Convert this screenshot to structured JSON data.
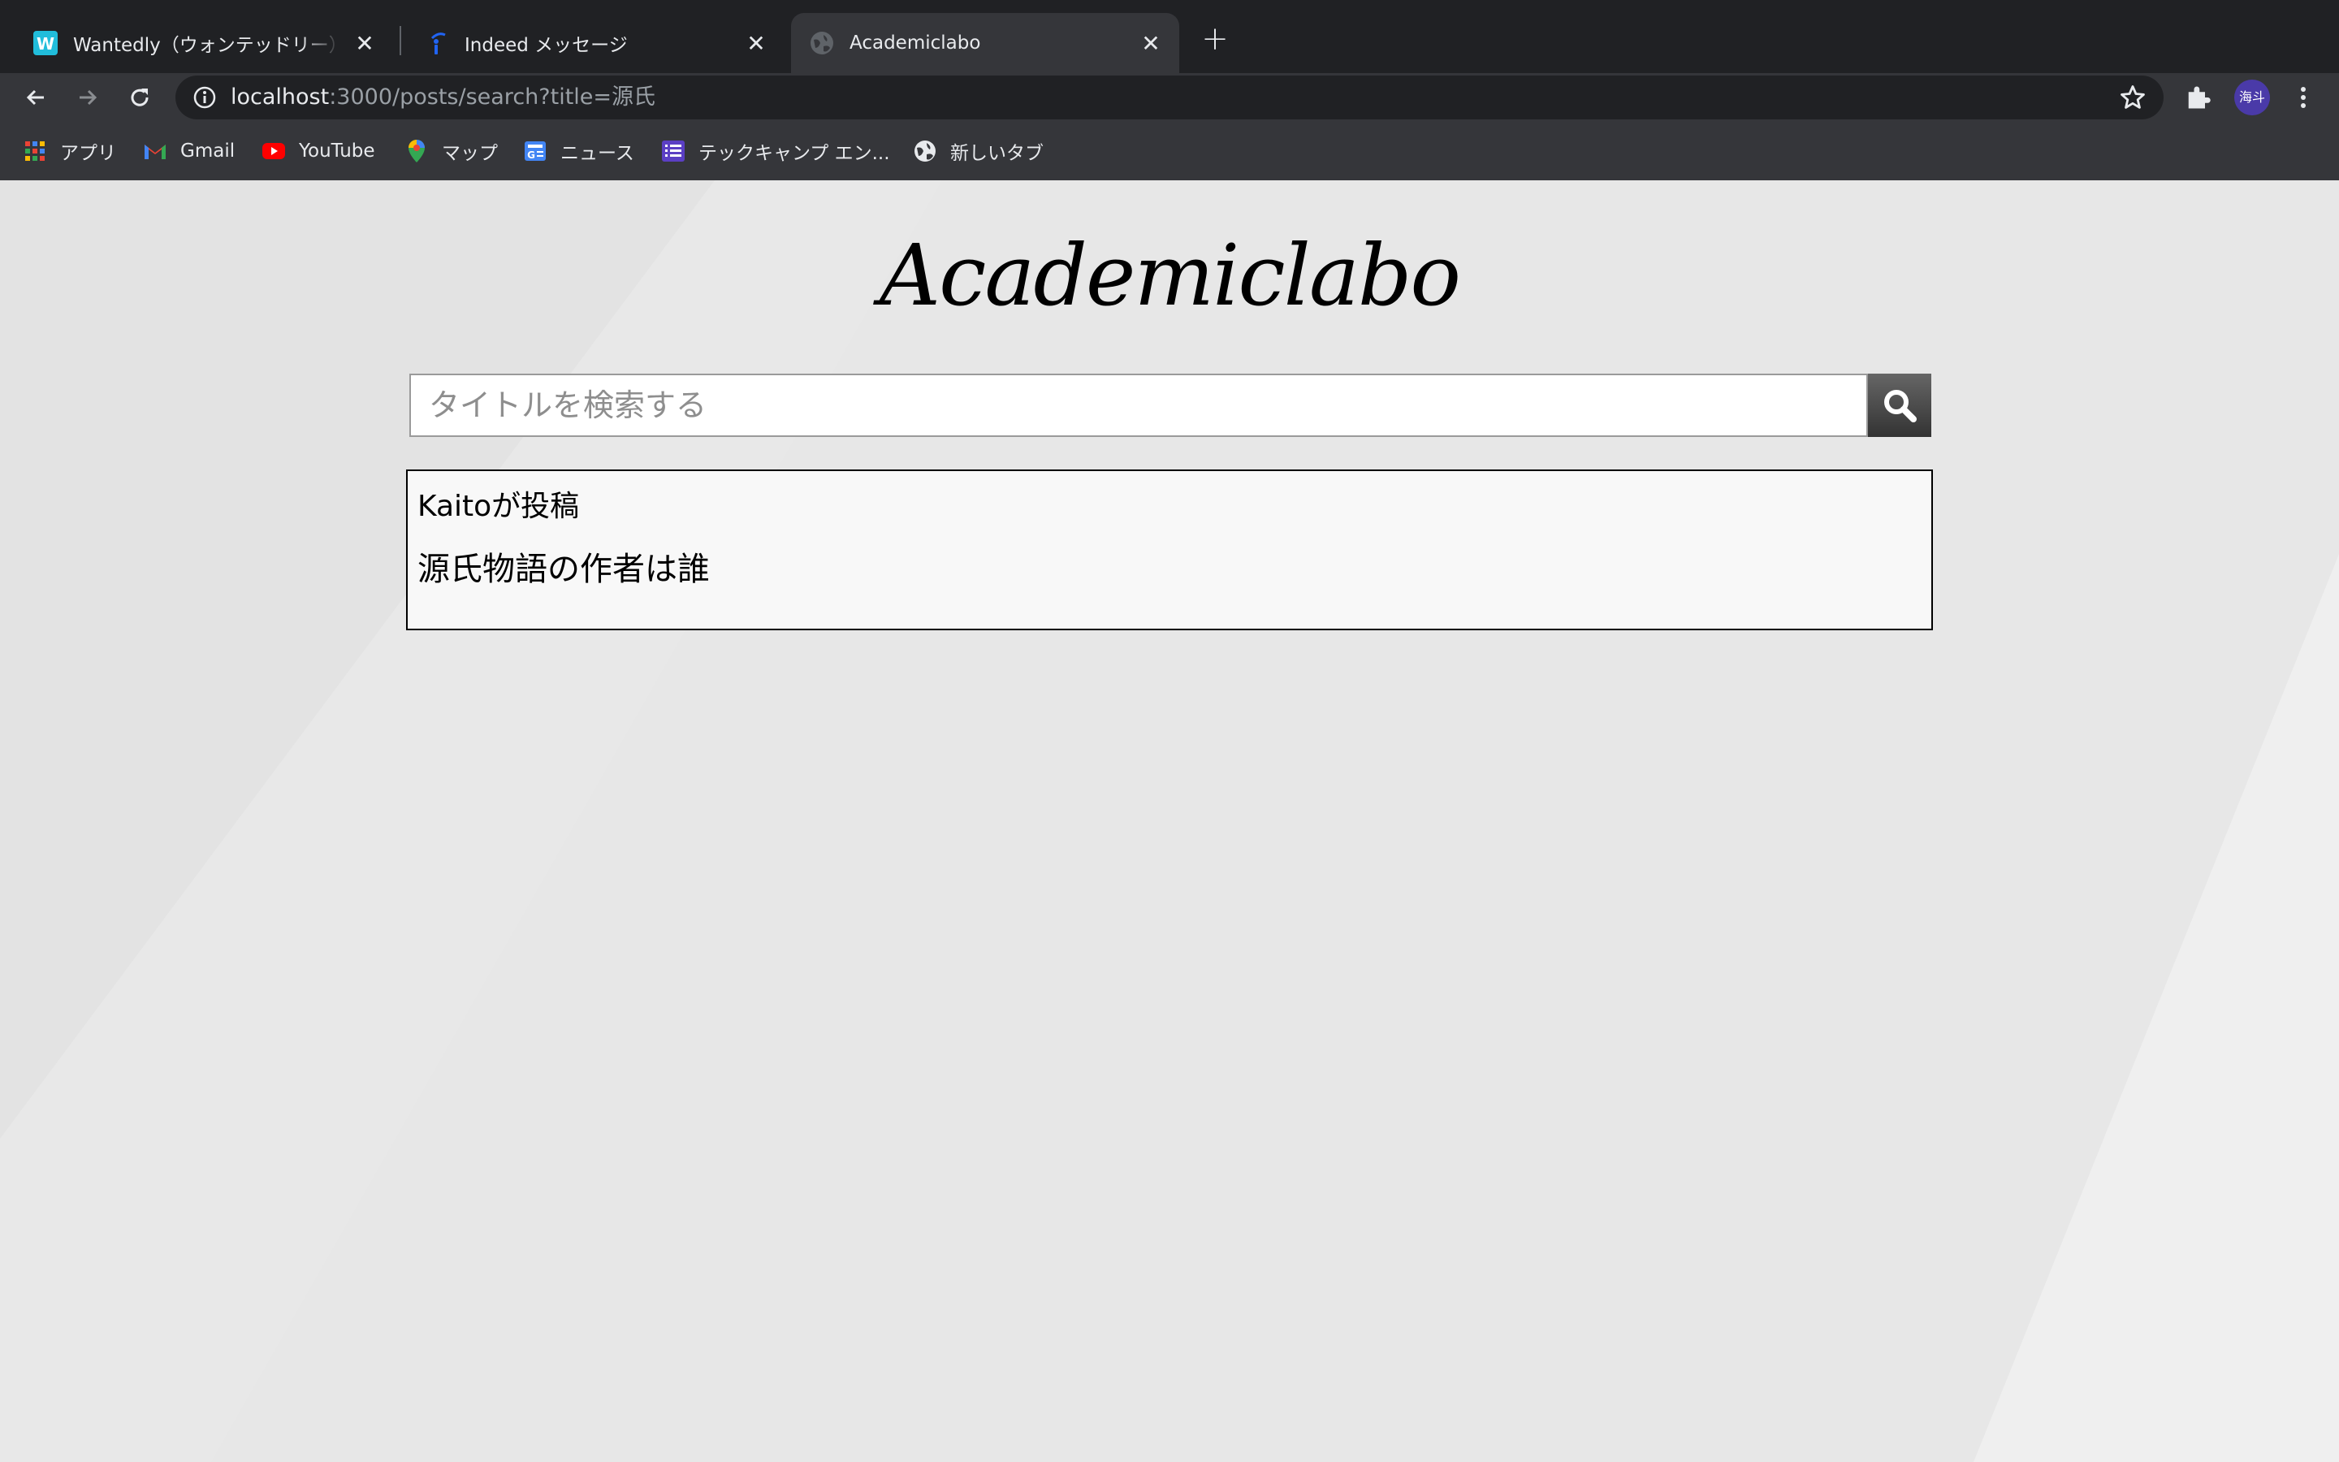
{
  "browser": {
    "tabs": [
      {
        "title": "Wantedly（ウォンテッドリー）は",
        "favicon": "wantedly-icon",
        "active": false
      },
      {
        "title": "Indeed メッセージ",
        "favicon": "indeed-icon",
        "active": false
      },
      {
        "title": "Academiclabo",
        "favicon": "globe-icon",
        "active": true
      }
    ],
    "url_host": "localhost",
    "url_rest": ":3000/posts/search?title=源氏",
    "profile_initials": "海斗",
    "bookmarks": [
      {
        "label": "アプリ",
        "icon": "apps-grid-icon"
      },
      {
        "label": "Gmail",
        "icon": "gmail-icon"
      },
      {
        "label": "YouTube",
        "icon": "youtube-icon"
      },
      {
        "label": "マップ",
        "icon": "maps-icon"
      },
      {
        "label": "ニュース",
        "icon": "news-icon"
      },
      {
        "label": "テックキャンプ エン...",
        "icon": "list-icon"
      },
      {
        "label": "新しいタブ",
        "icon": "globe-icon"
      }
    ]
  },
  "site": {
    "title": "Academiclabo",
    "search": {
      "placeholder": "タイトルを検索する",
      "value": ""
    },
    "results": [
      {
        "author_line": "Kaitoが投稿",
        "title": "源氏物語の作者は誰"
      }
    ]
  },
  "colors": {
    "tabstrip": "#202124",
    "toolbar": "#35363a",
    "page_bg": "#e6e6e6"
  }
}
